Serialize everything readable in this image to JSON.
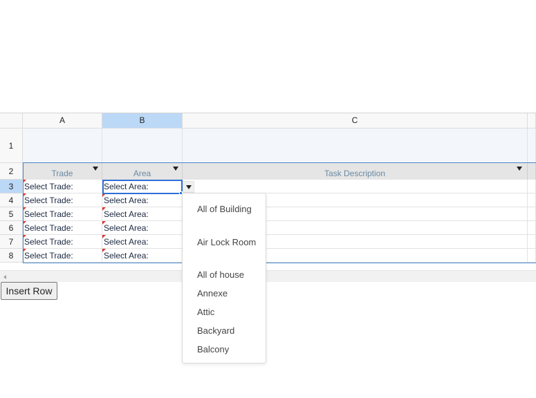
{
  "sheet": {
    "columns": [
      "A",
      "B",
      "C"
    ],
    "rows": [
      "1",
      "2",
      "3",
      "4",
      "5",
      "6",
      "7",
      "8"
    ],
    "header_row": {
      "trade": "Trade",
      "area": "Area",
      "task": "Task Description"
    },
    "data_rows": [
      {
        "trade": "Select Trade:",
        "area": "Select Area:"
      },
      {
        "trade": "Select Trade:",
        "area": "Select Area:"
      },
      {
        "trade": "Select Trade:",
        "area": "Select Area:"
      },
      {
        "trade": "Select Trade:",
        "area": "Select Area:"
      },
      {
        "trade": "Select Trade:",
        "area": "Select Area:"
      },
      {
        "trade": "Select Trade:",
        "area": "Select Area:"
      }
    ]
  },
  "dropdown": {
    "options": [
      "All of Building",
      "Air Lock Room",
      "All of house",
      "Annexe",
      "Attic",
      "Backyard",
      "Balcony"
    ]
  },
  "insert_row_label": "Insert Row"
}
